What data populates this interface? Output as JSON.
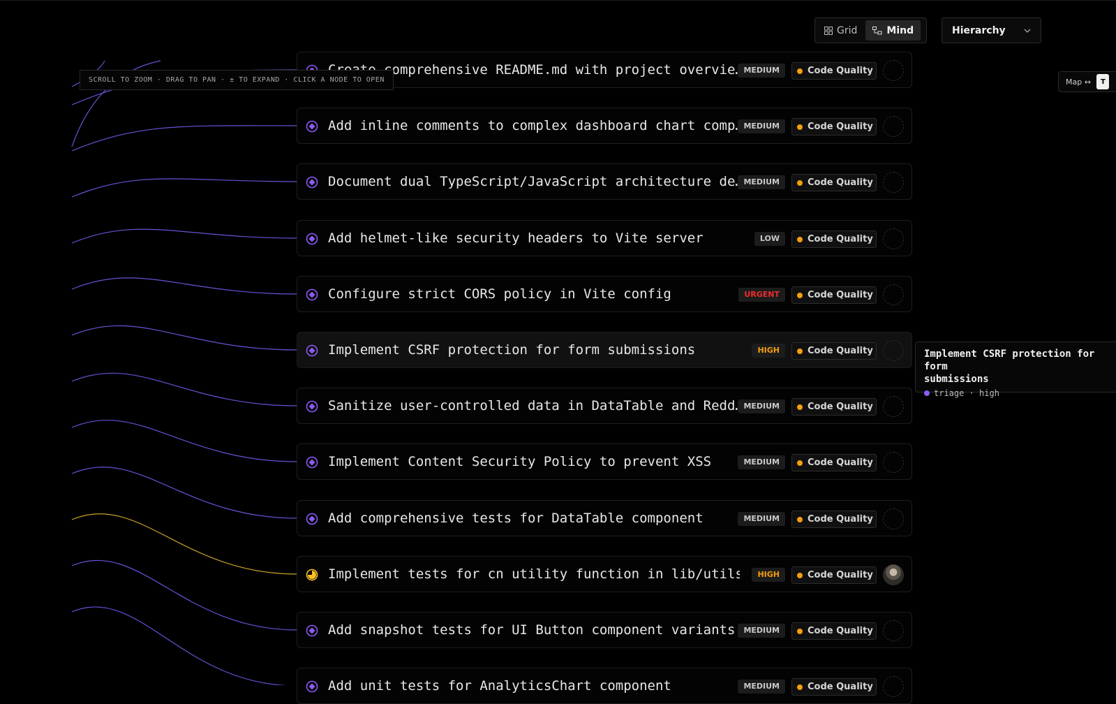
{
  "view_toggle": {
    "options": [
      {
        "label": "Grid",
        "icon": "grid-icon",
        "active": false
      },
      {
        "label": "Mind",
        "icon": "mind-map-icon",
        "active": true
      }
    ]
  },
  "layout_select": {
    "value": "Hierarchy",
    "icon": "chevron-down-icon"
  },
  "canvas_hint": "SCROLL TO ZOOM · DRAG TO PAN · ± TO EXPAND · CLICK A NODE TO OPEN",
  "map_toggle": {
    "label": "Map ↔",
    "mini": "T"
  },
  "colors": {
    "edge_default": "#6d4fd6",
    "edge_in_progress": "#c9a227",
    "status_backlog": "#8b5cf6",
    "status_in_progress": "#fbbf24",
    "priority_high": "#f59e0b",
    "priority_urgent": "#ef2c2c",
    "tag_dot": "#f59e0b"
  },
  "nodes": [
    {
      "title": "Create comprehensive README.md with project overvie…",
      "priority": "MEDIUM",
      "tag": "Code Quality",
      "status": "backlog"
    },
    {
      "title": "Add inline comments to complex dashboard chart comp…",
      "priority": "MEDIUM",
      "tag": "Code Quality",
      "status": "backlog"
    },
    {
      "title": "Document dual TypeScript/JavaScript architecture de…",
      "priority": "MEDIUM",
      "tag": "Code Quality",
      "status": "backlog"
    },
    {
      "title": "Add helmet-like security headers to Vite server",
      "priority": "LOW",
      "tag": "Code Quality",
      "status": "backlog"
    },
    {
      "title": "Configure strict CORS policy in Vite config",
      "priority": "URGENT",
      "tag": "Code Quality",
      "status": "backlog"
    },
    {
      "title": "Implement CSRF protection for form submissions",
      "priority": "HIGH",
      "tag": "Code Quality",
      "status": "backlog"
    },
    {
      "title": "Sanitize user-controlled data in DataTable and Redd…",
      "priority": "MEDIUM",
      "tag": "Code Quality",
      "status": "backlog"
    },
    {
      "title": "Implement Content Security Policy to prevent XSS",
      "priority": "MEDIUM",
      "tag": "Code Quality",
      "status": "backlog"
    },
    {
      "title": "Add comprehensive tests for DataTable component",
      "priority": "MEDIUM",
      "tag": "Code Quality",
      "status": "backlog"
    },
    {
      "title": "Implement tests for cn utility function in lib/utils…",
      "priority": "HIGH",
      "tag": "Code Quality",
      "status": "in-progress"
    },
    {
      "title": "Add snapshot tests for UI Button component variants",
      "priority": "MEDIUM",
      "tag": "Code Quality",
      "status": "backlog"
    },
    {
      "title": "Add unit tests for AnalyticsChart component",
      "priority": "MEDIUM",
      "tag": "Code Quality",
      "status": "backlog"
    }
  ],
  "tooltip": {
    "title": "Implement CSRF protection for form\nsubmissions",
    "meta": "triage · high"
  }
}
